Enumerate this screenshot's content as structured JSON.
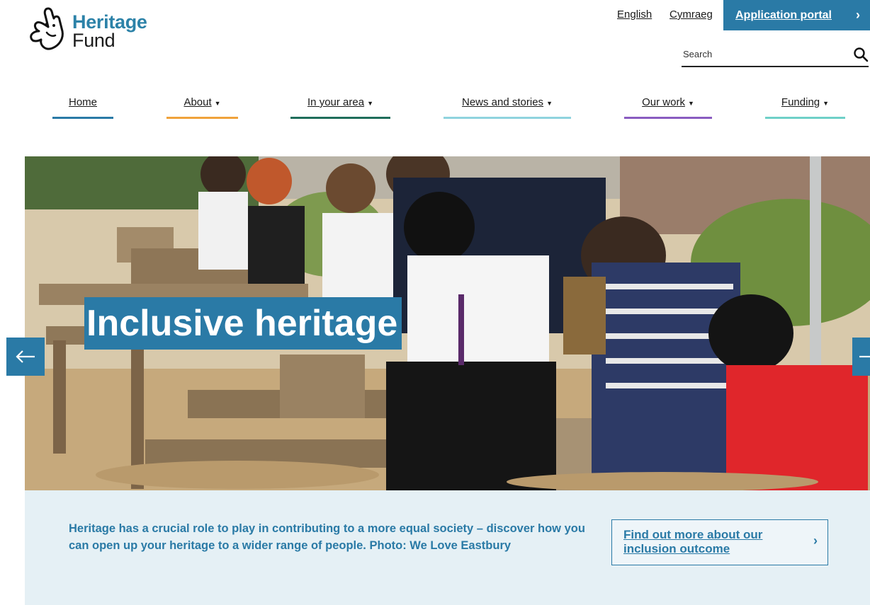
{
  "brand": {
    "logo_line1": "Heritage",
    "logo_line2": "Fund",
    "primary_color": "#2a7aa6",
    "logo_icon": "crossed-fingers-logo-icon"
  },
  "header": {
    "language_links": [
      "English",
      "Cymraeg"
    ],
    "portal_button_label": "Application portal",
    "search_placeholder": "Search",
    "search_icon": "search-icon"
  },
  "nav": {
    "items": [
      {
        "label": "Home",
        "has_dropdown": false,
        "accent": "#2a7aa6"
      },
      {
        "label": "About",
        "has_dropdown": true,
        "accent": "#f0a23b"
      },
      {
        "label": "In your area",
        "has_dropdown": true,
        "accent": "#1f6e5b"
      },
      {
        "label": "News and stories",
        "has_dropdown": true,
        "accent": "#8fd3de"
      },
      {
        "label": "Our work",
        "has_dropdown": true,
        "accent": "#8a5cc0"
      },
      {
        "label": "Funding",
        "has_dropdown": true,
        "accent": "#6fd0c8"
      }
    ]
  },
  "hero": {
    "title": "Inclusive heritage",
    "prev_icon": "arrow-left-icon",
    "next_icon": "arrow-right-icon"
  },
  "caption": {
    "text": "Heritage has a crucial role to play in contributing to a more equal society – discover how you can open up your heritage to a wider range of people. Photo: We Love Eastbury",
    "cta_label": "Find out more about our inclusion outcome",
    "cta_icon": "chevron-right-icon"
  }
}
